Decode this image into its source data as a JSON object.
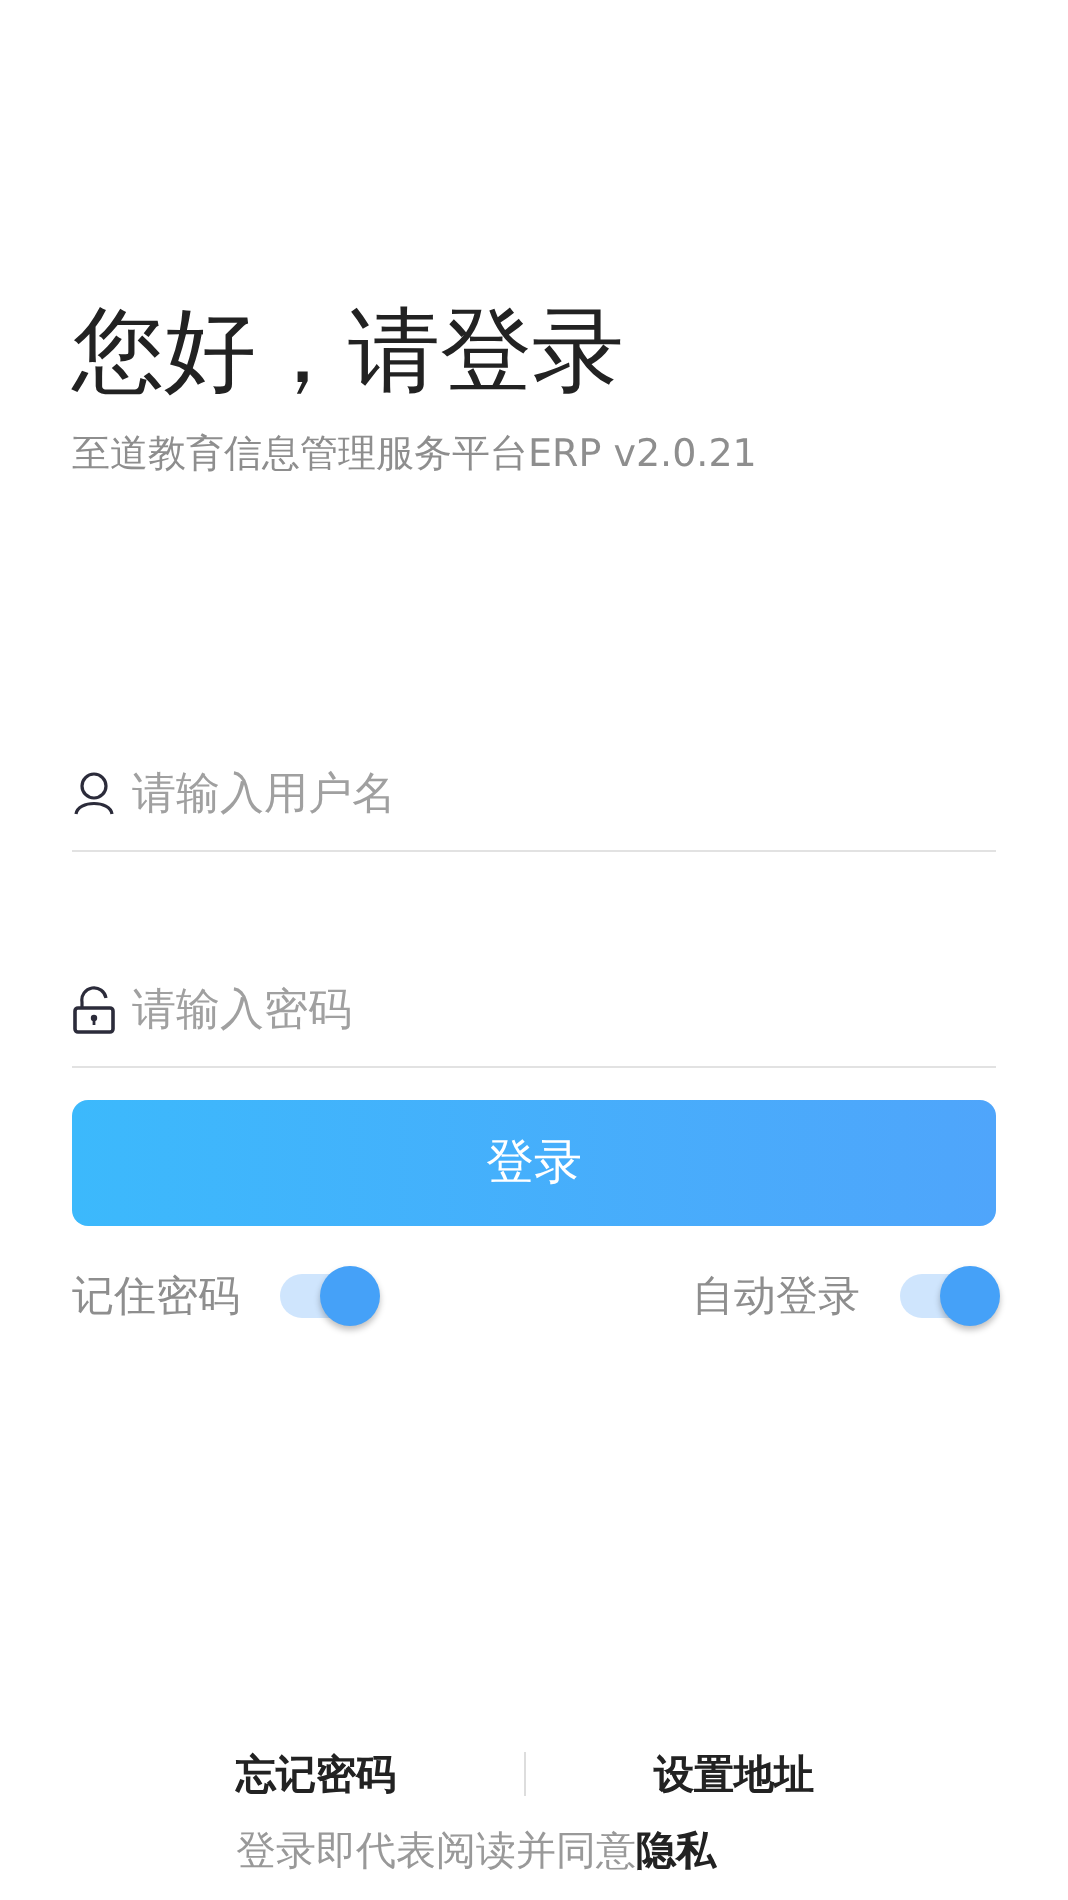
{
  "title": "您好，请登录",
  "subtitle": "至道教育信息管理服务平台ERP v2.0.21",
  "fields": [
    {
      "kind": "user",
      "placeholder": "请输入用户名"
    },
    {
      "kind": "password",
      "placeholder": "请输入密码"
    }
  ],
  "login_button": "登录",
  "toggles": [
    {
      "label": "记住密码",
      "on": true
    },
    {
      "label": "自动登录",
      "on": true
    }
  ],
  "footer_links": [
    "忘记密码",
    "设置地址"
  ],
  "agreement": "登录即代表阅读并同意**隐私**"
}
